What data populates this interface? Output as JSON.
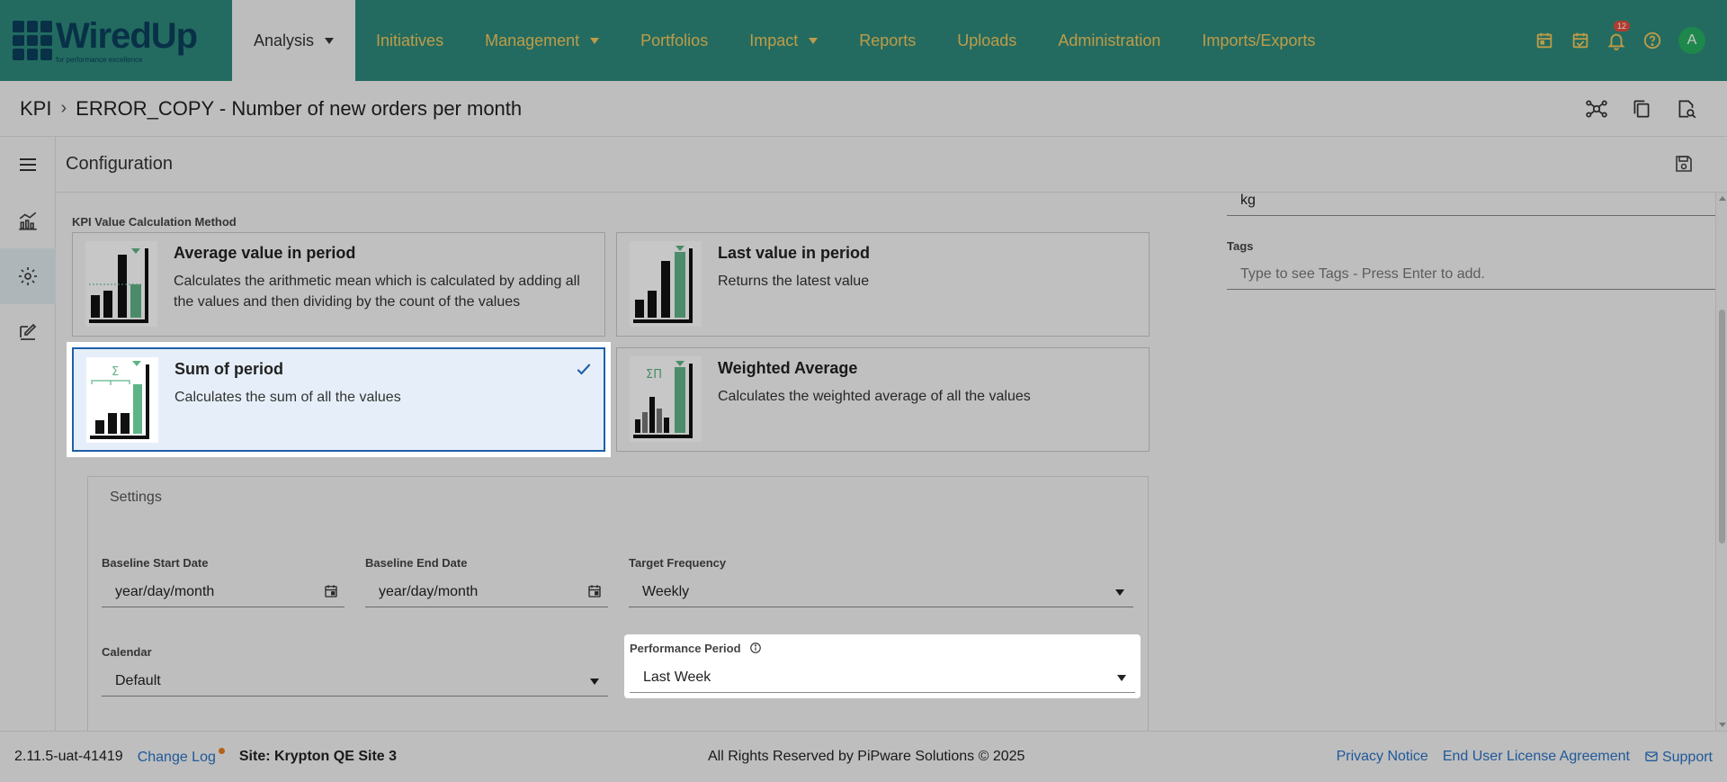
{
  "nav": {
    "logo_text": "WiredUp",
    "logo_sub": "for performance excellence",
    "items": [
      {
        "label": "Analysis",
        "active": true,
        "dropdown": true
      },
      {
        "label": "Initiatives",
        "active": false,
        "dropdown": false
      },
      {
        "label": "Management",
        "active": false,
        "dropdown": true
      },
      {
        "label": "Portfolios",
        "active": false,
        "dropdown": false
      },
      {
        "label": "Impact",
        "active": false,
        "dropdown": true
      },
      {
        "label": "Reports",
        "active": false,
        "dropdown": false
      },
      {
        "label": "Uploads",
        "active": false,
        "dropdown": false
      },
      {
        "label": "Administration",
        "active": false,
        "dropdown": false
      },
      {
        "label": "Imports/Exports",
        "active": false,
        "dropdown": false
      }
    ],
    "notification_count": "12",
    "avatar_initial": "A"
  },
  "breadcrumb": {
    "root": "KPI",
    "current": "ERROR_COPY - Number of new orders per month"
  },
  "config": {
    "title": "Configuration"
  },
  "calc_method": {
    "label": "KPI Value Calculation Method",
    "options": [
      {
        "title": "Average value in period",
        "desc": "Calculates the arithmetic mean which is calculated by adding all the values and then dividing by the count of the values",
        "selected": false
      },
      {
        "title": "Last value in period",
        "desc": "Returns the latest value",
        "selected": false
      },
      {
        "title": "Sum of period",
        "desc": "Calculates the sum of all the values",
        "selected": true
      },
      {
        "title": "Weighted Average",
        "desc": "Calculates the weighted average of all the values",
        "selected": false
      }
    ]
  },
  "settings": {
    "title": "Settings",
    "baseline_start": {
      "label": "Baseline Start Date",
      "value": "year/day/month"
    },
    "baseline_end": {
      "label": "Baseline End Date",
      "value": "year/day/month"
    },
    "target_frequency": {
      "label": "Target Frequency",
      "value": "Weekly"
    },
    "calendar": {
      "label": "Calendar",
      "value": "Default"
    },
    "performance_period": {
      "label": "Performance Period",
      "value": "Last Week"
    }
  },
  "right": {
    "unit_value": "kg",
    "tags_label": "Tags",
    "tags_placeholder": "Type to see Tags - Press Enter to add."
  },
  "footer": {
    "version": "2.11.5-uat-41419",
    "changelog": "Change Log",
    "site": "Site: Krypton QE Site 3",
    "copyright": "All Rights Reserved by PiPware Solutions © 2025",
    "privacy": "Privacy Notice",
    "eula": "End User License Agreement",
    "support": "Support"
  },
  "colors": {
    "nav_bg": "#2e8a7b",
    "nav_text": "#f3c85d",
    "accent_blue": "#1e5fa8",
    "chart_green": "#5fb487"
  }
}
